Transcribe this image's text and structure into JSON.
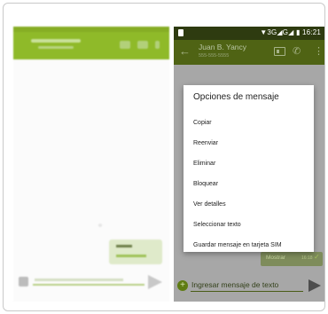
{
  "status_bar": {
    "network_text": "▼3G◢G◢ ▮ 16:21"
  },
  "app_bar": {
    "back_icon": "←",
    "contact_name": "Juan B. Yancy",
    "contact_subtitle": "555-555-5555",
    "phone_icon": "✆",
    "menu_icon": "⋮"
  },
  "message": {
    "text": "Mostrar",
    "meta": "16:18",
    "check_icon": "✓"
  },
  "compose": {
    "plus_icon": "+",
    "placeholder": "Ingresar mensaje de texto"
  },
  "dialog": {
    "title": "Opciones de mensaje",
    "items": [
      "Copiar",
      "Reenviar",
      "Eliminar",
      "Bloquear",
      "Ver detalles",
      "Seleccionar texto",
      "Guardar mensaje en tarjeta SIM"
    ]
  },
  "colors": {
    "status_bar": "#2e3b10",
    "app_bar": "#4f6314",
    "scrim": "#a7a7a7",
    "dialog": "#ffffff",
    "accent": "#5f7c13"
  }
}
